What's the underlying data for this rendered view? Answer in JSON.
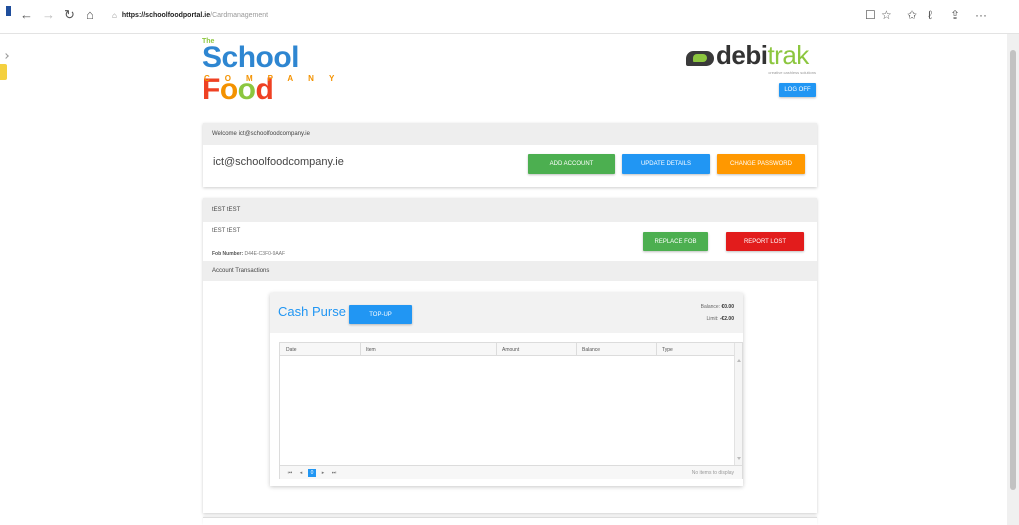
{
  "browser": {
    "back": "←",
    "forward": "→",
    "refresh": "↻",
    "home": "⌂",
    "url_host": "https://schoolfoodportal.ie",
    "url_path": "/Cardmanagement",
    "reading_icon": "☐",
    "favorite_icon": "☆",
    "favorites_icon": "✩",
    "pen_icon": "ℓ",
    "share_icon": "⇪",
    "more_icon": "···"
  },
  "logo_sfc": {
    "the": "The",
    "school": "School",
    "f": "F",
    "o1": "o",
    "o2": "o",
    "d": "d",
    "company": "COMPANY"
  },
  "logo_debitrak": {
    "debi": "debi",
    "trak": "trak",
    "tagline": "creative cashless solutions"
  },
  "header": {
    "logoff": "LOG OFF"
  },
  "welcome": {
    "heading": "Welcome ict@schoolfoodcompany.ie",
    "email": "ict@schoolfoodcompany.ie",
    "add_account": "ADD ACCOUNT",
    "update_details": "UPDATE DETAILS",
    "change_password": "CHANGE PASSWORD"
  },
  "account": {
    "heading": "tEST tEST",
    "name": "tEST tEST",
    "fob_label": "Fob Number:",
    "fob_value": "D44E-C3F0-9AAF",
    "replace_fob": "REPLACE FOB",
    "report_lost": "REPORT LOST",
    "transactions_heading": "Account Transactions"
  },
  "purse": {
    "title": "Cash Purse",
    "topup": "TOP-UP",
    "balance_label": "Balance:",
    "balance_value": "€0.00",
    "limit_label": "Limit:",
    "limit_value": "-€2.00",
    "columns": [
      "Date",
      "Item",
      "Amount",
      "Balance",
      "Type"
    ],
    "pager": {
      "first": "⏮",
      "prev": "◂",
      "page": "0",
      "next": "▸",
      "last": "⏭"
    },
    "empty_message": "No items to display"
  },
  "colors": {
    "blue": "#2196f3",
    "green": "#4caf50",
    "orange": "#ff9800",
    "red": "#e21c1c"
  }
}
